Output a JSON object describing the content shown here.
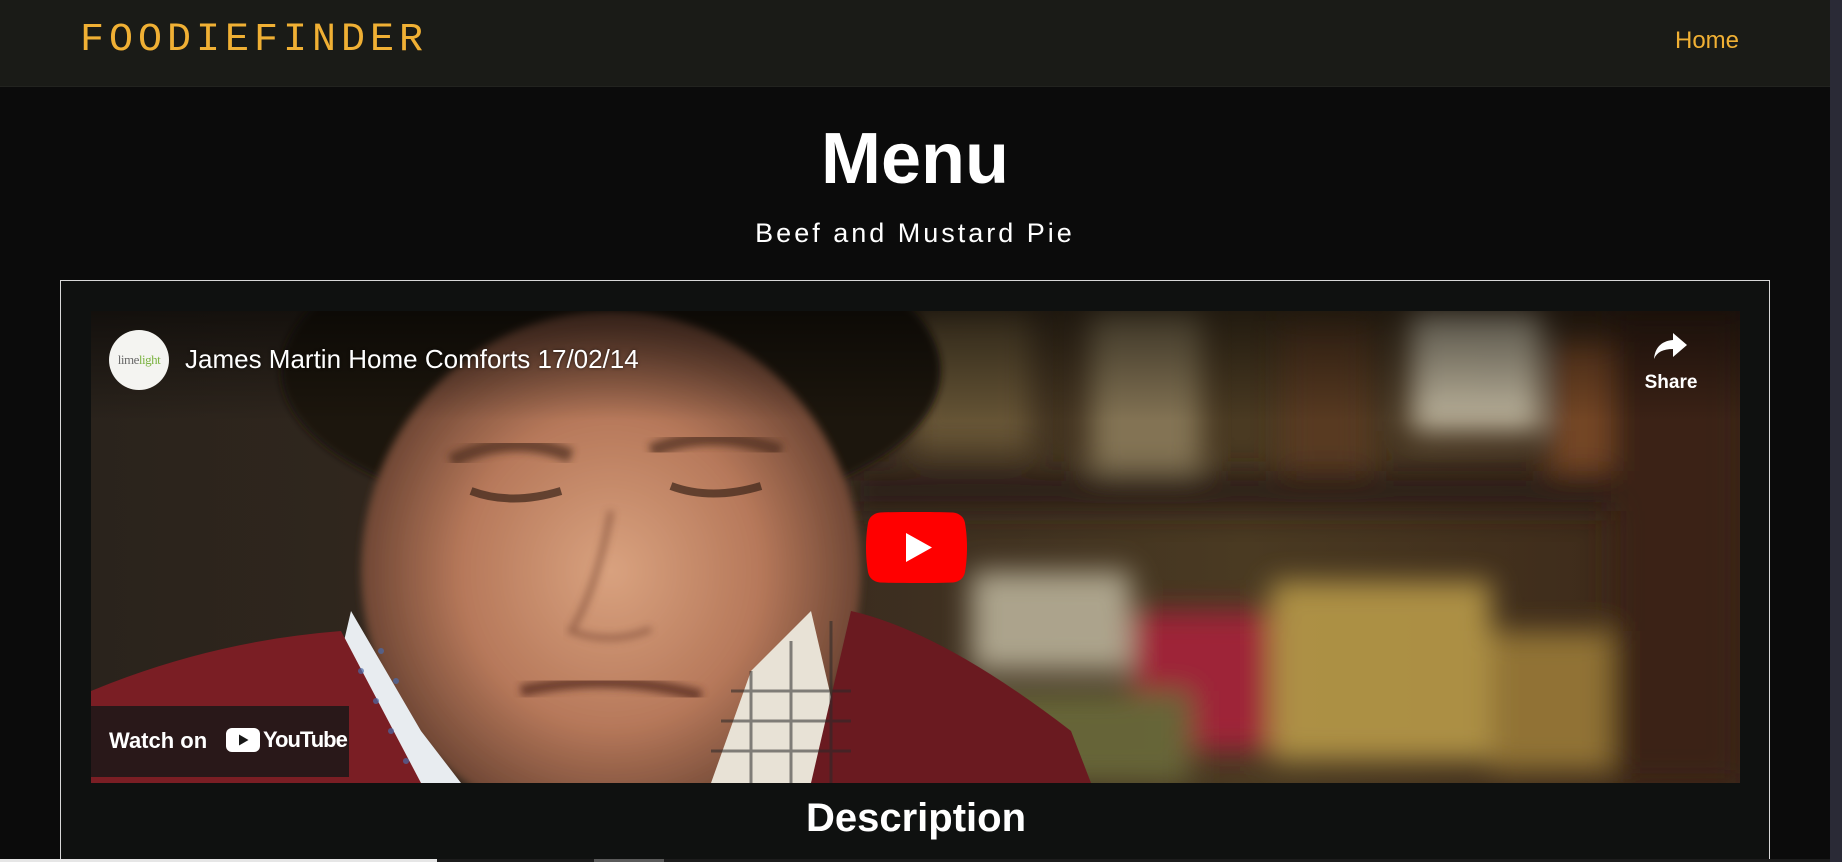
{
  "navbar": {
    "brand": "FOODIEFINDER",
    "links": [
      {
        "label": "Home"
      }
    ]
  },
  "page": {
    "title": "Menu",
    "dish_name": "Beef and Mustard Pie"
  },
  "video": {
    "title": "James Martin Home Comforts 17/02/14",
    "channel_avatar_text": "lime",
    "channel_avatar_text_accent": "light",
    "share_label": "Share",
    "watch_on_label": "Watch on",
    "platform_label": "YouTube",
    "icons": {
      "share": "share-arrow-icon",
      "play": "play-button-icon",
      "platform": "youtube-logo-icon"
    }
  },
  "content": {
    "section_heading": "Description"
  },
  "colors": {
    "accent": "#f0b034",
    "navbar_bg": "#1a1b17",
    "page_bg": "#0b0b0b",
    "play_red": "#ff0000"
  }
}
